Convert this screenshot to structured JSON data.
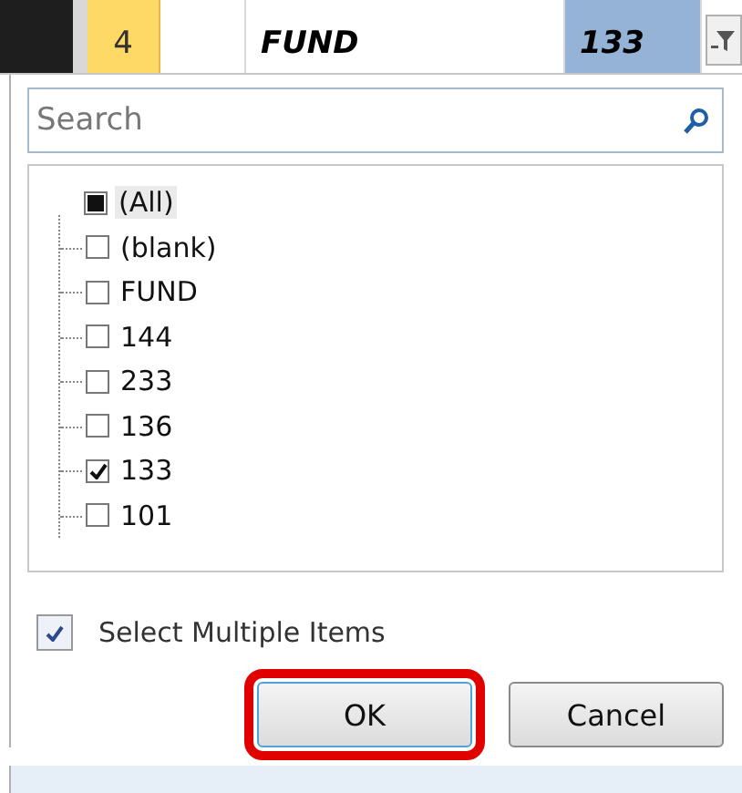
{
  "header_row": {
    "cells": [
      {
        "text": "4",
        "kind": "number"
      },
      {
        "text": "",
        "kind": "blank"
      },
      {
        "text": "FUND",
        "kind": "text"
      },
      {
        "text": "133",
        "kind": "filtered"
      }
    ]
  },
  "search": {
    "placeholder": "Search"
  },
  "items": [
    {
      "label": "(All)",
      "partial": true,
      "highlighted": true,
      "children": [
        {
          "label": "(blank)",
          "checked": false,
          "highlighted": false
        },
        {
          "label": "FUND",
          "checked": false,
          "highlighted": false
        },
        {
          "label": "144",
          "checked": false,
          "highlighted": false
        },
        {
          "label": "233",
          "checked": false,
          "highlighted": false
        },
        {
          "label": "136",
          "checked": false,
          "highlighted": false
        },
        {
          "label": "133",
          "checked": true,
          "highlighted": false
        },
        {
          "label": "101",
          "checked": false,
          "highlighted": false
        }
      ]
    }
  ],
  "select_multiple": {
    "label": "Select Multiple Items",
    "checked": true
  },
  "buttons": [
    {
      "label": "OK",
      "highlighted": true
    },
    {
      "label": "Cancel",
      "highlighted": false
    }
  ]
}
